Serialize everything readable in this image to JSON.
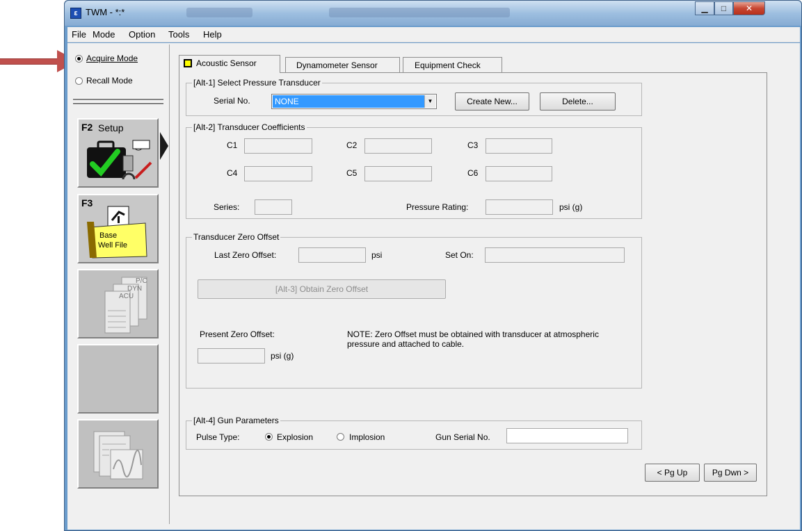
{
  "window": {
    "title": "TWM - *:*",
    "minimize": "▁",
    "maximize": "□",
    "close": "✕"
  },
  "menu": [
    "File",
    "Mode",
    "Option",
    "Tools",
    "Help"
  ],
  "mode": {
    "acquire": "Acquire Mode",
    "recall": "Recall Mode",
    "selected": "acquire"
  },
  "nav": {
    "setup_key": "F2",
    "setup_label": "Setup",
    "base_key": "F3",
    "base_label_1": "Base",
    "base_label_2": "Well File",
    "doc_labels": [
      "P/C",
      "DYN",
      "ACU"
    ]
  },
  "tabs": [
    "Acoustic Sensor",
    "Dynamometer Sensor",
    "Equipment Check"
  ],
  "select_transducer": {
    "group_title": "[Alt-1]  Select Pressure Transducer",
    "serial_label": "Serial No.",
    "serial_value": "NONE",
    "create_new": "Create New...",
    "delete": "Delete..."
  },
  "coefficients": {
    "group_title": "[Alt-2]  Transducer Coefficients",
    "labels": [
      "C1",
      "C2",
      "C3",
      "C4",
      "C5",
      "C6"
    ],
    "series_label": "Series:",
    "pressure_rating_label": "Pressure Rating:",
    "pressure_unit": "psi (g)"
  },
  "zero_offset": {
    "group_title": "Transducer Zero Offset",
    "last_label": "Last Zero Offset:",
    "last_unit": "psi",
    "set_on_label": "Set On:",
    "obtain_button": "[Alt-3]  Obtain Zero Offset",
    "present_label": "Present Zero Offset:",
    "present_unit": "psi (g)",
    "note": "NOTE:  Zero Offset must be obtained with transducer at atmospheric pressure and attached to cable."
  },
  "gun": {
    "group_title": "[Alt-4]  Gun Parameters",
    "pulse_label": "Pulse Type:",
    "explosion": "Explosion",
    "implosion": "Implosion",
    "pulse_selected": "explosion",
    "serial_label": "Gun Serial No."
  },
  "paging": {
    "pg_up": "< Pg Up",
    "pg_down": "Pg Dwn >"
  },
  "colors": {
    "accent_arrow": "#c0504d",
    "selection": "#3399ff",
    "tab_icon": "#ffff00",
    "base_folder": "#ffff66"
  }
}
